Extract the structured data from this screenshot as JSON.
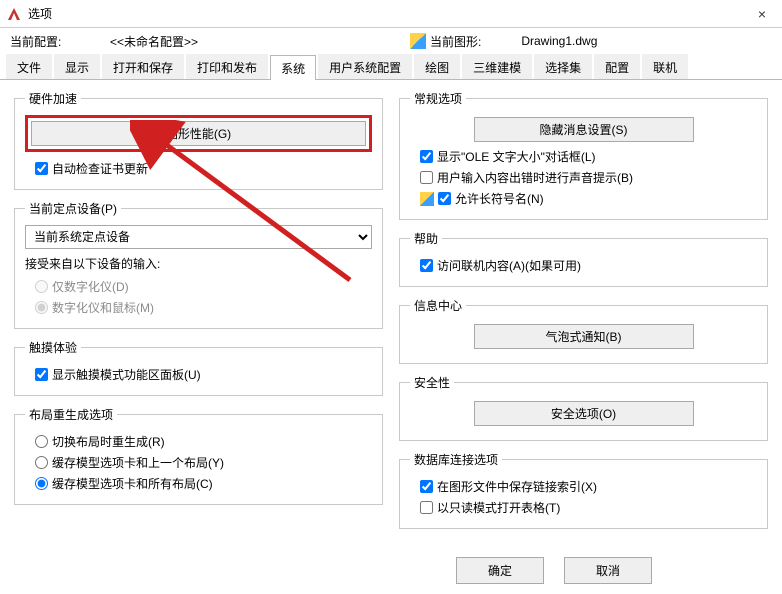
{
  "window": {
    "title": "选项",
    "close": "×"
  },
  "header": {
    "current_profile_label": "当前配置:",
    "current_profile_value": "<<未命名配置>>",
    "current_drawing_label": "当前图形:",
    "current_drawing_value": "Drawing1.dwg"
  },
  "tabs": [
    "文件",
    "显示",
    "打开和保存",
    "打印和发布",
    "系统",
    "用户系统配置",
    "绘图",
    "三维建模",
    "选择集",
    "配置",
    "联机"
  ],
  "active_tab_index": 4,
  "left": {
    "hw": {
      "legend": "硬件加速",
      "perf_button": "图形性能(G)",
      "auto_cert": "自动检查证书更新"
    },
    "pointing": {
      "legend": "当前定点设备(P)",
      "dropdown_value": "当前系统定点设备",
      "accept_label": "接受来自以下设备的输入:",
      "opt_digitizer": "仅数字化仪(D)",
      "opt_both": "数字化仪和鼠标(M)"
    },
    "touch": {
      "legend": "触摸体验",
      "show_touch": "显示触摸模式功能区面板(U)"
    },
    "regen": {
      "legend": "布局重生成选项",
      "opt_switch": "切换布局时重生成(R)",
      "opt_cache_last": "缓存模型选项卡和上一个布局(Y)",
      "opt_cache_all": "缓存模型选项卡和所有布局(C)"
    }
  },
  "right": {
    "general": {
      "legend": "常规选项",
      "hide_msg_btn": "隐藏消息设置(S)",
      "ole_size": "显示\"OLE 文字大小\"对话框(L)",
      "beep": "用户输入内容出错时进行声音提示(B)",
      "long_names": "允许长符号名(N)"
    },
    "help": {
      "legend": "帮助",
      "online": "访问联机内容(A)(如果可用)"
    },
    "info": {
      "legend": "信息中心",
      "balloon_btn": "气泡式通知(B)"
    },
    "security": {
      "legend": "安全性",
      "sec_btn": "安全选项(O)"
    },
    "db": {
      "legend": "数据库连接选项",
      "save_index": "在图形文件中保存链接索引(X)",
      "readonly": "以只读模式打开表格(T)"
    }
  },
  "dialog": {
    "ok": "确定",
    "cancel": "取消"
  }
}
